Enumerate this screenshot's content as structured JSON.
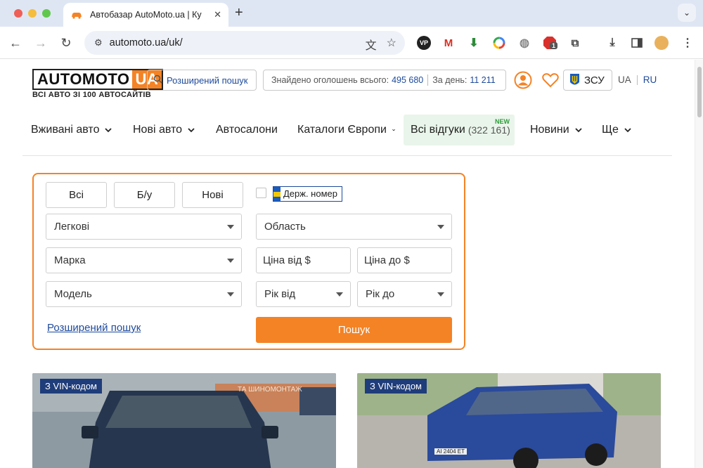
{
  "browser": {
    "tab_title": "Автобазар AutoMoto.ua | Ку",
    "url": "automoto.ua/uk/",
    "new_tab_label": "+",
    "ext_badge": "1"
  },
  "header": {
    "logo_part1": "AUTOMOTO",
    "logo_part2": "UA",
    "slogan": "ВСІ АВТО ЗІ 100 АВТОСАЙТІВ",
    "advanced_search": "Розширений пошук",
    "counter_label": "Знайдено оголошень всього:",
    "counter_total": "495 680",
    "per_day_label": "За день:",
    "per_day_value": "11 211",
    "zsu_label": "ЗСУ",
    "lang_ua": "UA",
    "lang_ru": "RU"
  },
  "nav": {
    "used": "Вживані авто",
    "new": "Нові авто",
    "dealers": "Автосалони",
    "catalogs": "Каталоги Європи",
    "reviews": "Всі відгуки",
    "reviews_count": "(322 161)",
    "new_badge": "NEW",
    "news": "Новини",
    "more": "Ще"
  },
  "search": {
    "seg_all": "Всі",
    "seg_used": "Б/у",
    "seg_new": "Нові",
    "plate_label": "Держ. номер",
    "type_value": "Легкові",
    "region_value": "Область",
    "make_value": "Марка",
    "price_from": "Ціна від $",
    "price_to": "Ціна до $",
    "model_value": "Модель",
    "year_from": "Рік від",
    "year_to": "Рік до",
    "advanced_link": "Розширений пошук",
    "submit": "Пошук"
  },
  "cards": [
    {
      "badge": "З VIN-кодом",
      "sign_text": "ТА ШИНОМОНТАЖ"
    },
    {
      "badge": "З VIN-кодом",
      "plate_text": "АІ 2404 ЕТ"
    }
  ]
}
